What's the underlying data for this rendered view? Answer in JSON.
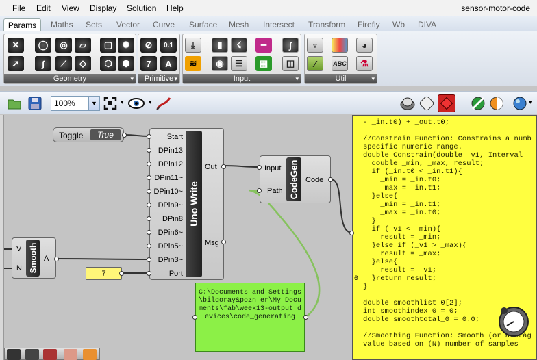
{
  "menu": {
    "items": [
      "File",
      "Edit",
      "View",
      "Display",
      "Solution",
      "Help"
    ],
    "document_title": "sensor-motor-code"
  },
  "tabs": [
    "Params",
    "Maths",
    "Sets",
    "Vector",
    "Curve",
    "Surface",
    "Mesh",
    "Intersect",
    "Transform",
    "Firefly",
    "Wb",
    "DIVA"
  ],
  "active_tab": "Params",
  "ribbon": {
    "groups": [
      "Geometry",
      "Primitive",
      "Input",
      "Util"
    ],
    "primitive_glyphs": {
      "seven": "7",
      "a": "A",
      "zero_one": "0.1"
    },
    "util_glyph": "ABC"
  },
  "toolbar": {
    "zoom": "100%"
  },
  "canvas": {
    "toggle": {
      "label": "Toggle",
      "value": "True"
    },
    "uno_write": {
      "name": "Uno Write",
      "inputs": [
        "Start",
        "DPin13",
        "DPin12",
        "DPin11~",
        "DPin10~",
        "DPin9~",
        "DPin8",
        "DPin6~",
        "DPin5~",
        "DPin3~",
        "Port"
      ],
      "outputs": [
        "Out",
        "Msg"
      ]
    },
    "codegen": {
      "name": "CodeGen",
      "inputs": [
        "Input",
        "Path"
      ],
      "outputs": [
        "Code"
      ]
    },
    "smooth": {
      "name": "Smooth",
      "inputs": [
        "V",
        "N"
      ],
      "outputs": [
        "A"
      ]
    },
    "port_panel": {
      "value": "7"
    },
    "path_panel": {
      "text": "C:\\Documents and Settings\\bilgoray&pozn er\\My Documents\\fab\\week13-output devices\\code_generating"
    },
    "code_line_number": "0",
    "code_text": "- _in.t0) + _out.t0;\n\n//Constrain Function: Constrains a numb\nspecific numeric range.\ndouble Constrain(double _v1, Interval _\n  double _min, _max, result;\n  if (_in.t0 < _in.t1){\n    _min = _in.t0;\n    _max = _in.t1;\n  }else{\n    _min = _in.t1;\n    _max = _in.t0;\n  }\n  if (_v1 < _min){\n    result = _min;\n  }else if (_v1 > _max){\n    result = _max;\n  }else{\n    result = _v1;\n  }return result;\n}\n\ndouble smoothlist_0[2];\nint smoothindex_0 = 0;\ndouble smoothtotal_0 = 0.0;\n\n//Smoothing Function: Smooth (or averag\nvalue based on (N) number of samples"
  },
  "colors": {
    "canvas_bg": "#c4c4c4",
    "code_bg": "#ffff40",
    "path_panel_bg": "#8cf047",
    "wire_green": "#86c25e",
    "wire_dark": "#333333"
  }
}
